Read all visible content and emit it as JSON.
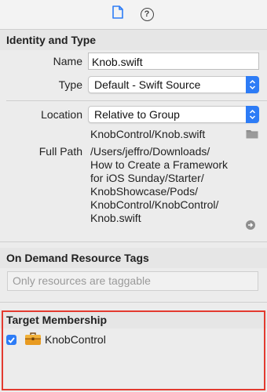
{
  "toolbar": {
    "file_inspector_icon": "document-icon",
    "quick_help_icon": "question-circle-icon",
    "quick_help_glyph": "?"
  },
  "identity": {
    "header": "Identity and Type",
    "name_label": "Name",
    "name_value": "Knob.swift",
    "type_label": "Type",
    "type_value": "Default - Swift Source",
    "location_label": "Location",
    "location_value": "Relative to Group",
    "relative_path": "KnobControl/Knob.swift",
    "full_path_label": "Full Path",
    "full_path_lines": [
      "/Users/jeffro/Downloads/",
      "How to Create a Framework",
      "for iOS Sunday/Starter/",
      "KnobShowcase/Pods/",
      "KnobControl/KnobControl/",
      "Knob.swift"
    ]
  },
  "on_demand": {
    "header": "On Demand Resource Tags",
    "placeholder": "Only resources are taggable"
  },
  "target_membership": {
    "header": "Target Membership",
    "targets": [
      {
        "name": "KnobControl",
        "checked": true,
        "icon": "toolbox-icon"
      }
    ]
  },
  "colors": {
    "accent": "#2d7cf6",
    "highlight": "#e33a2f"
  }
}
